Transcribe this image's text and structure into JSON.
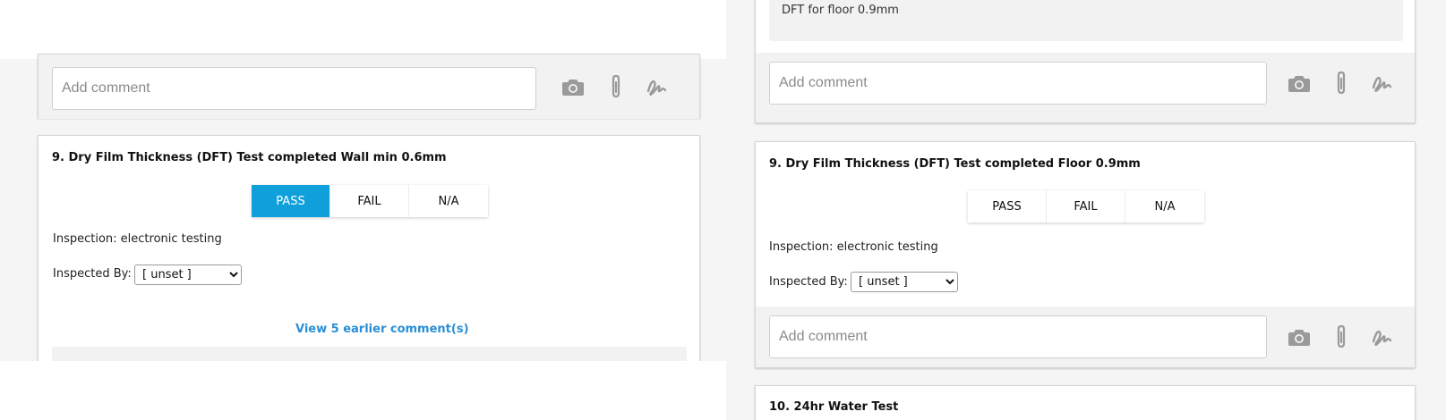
{
  "left": {
    "top_comment": {
      "placeholder": "Add comment"
    },
    "question": {
      "title": "9. Dry Film Thickness (DFT) Test completed Wall min 0.6mm",
      "options": [
        "PASS",
        "FAIL",
        "N/A"
      ],
      "selected": "PASS",
      "inspection_text": "Inspection: electronic testing",
      "inspected_by_label": "Inspected By:",
      "inspected_by_value": "[ unset ]",
      "view_comments_link": "View 5 earlier comment(s)"
    }
  },
  "right": {
    "note": {
      "text": "DFT for floor 0.9mm"
    },
    "top_comment": {
      "placeholder": "Add comment"
    },
    "question": {
      "title": "9. Dry Film Thickness (DFT) Test completed Floor 0.9mm",
      "options": [
        "PASS",
        "FAIL",
        "N/A"
      ],
      "selected": "",
      "inspection_text": "Inspection: electronic testing",
      "inspected_by_label": "Inspected By:",
      "inspected_by_value": "[ unset ]",
      "comment_placeholder": "Add comment"
    },
    "next_question": {
      "title": "10. 24hr Water Test"
    }
  },
  "colors": {
    "accent": "#0fa0dc",
    "link": "#2a8fd6",
    "icon": "#9a9a9a"
  },
  "icons": [
    "camera-icon",
    "paperclip-icon",
    "signature-icon"
  ]
}
